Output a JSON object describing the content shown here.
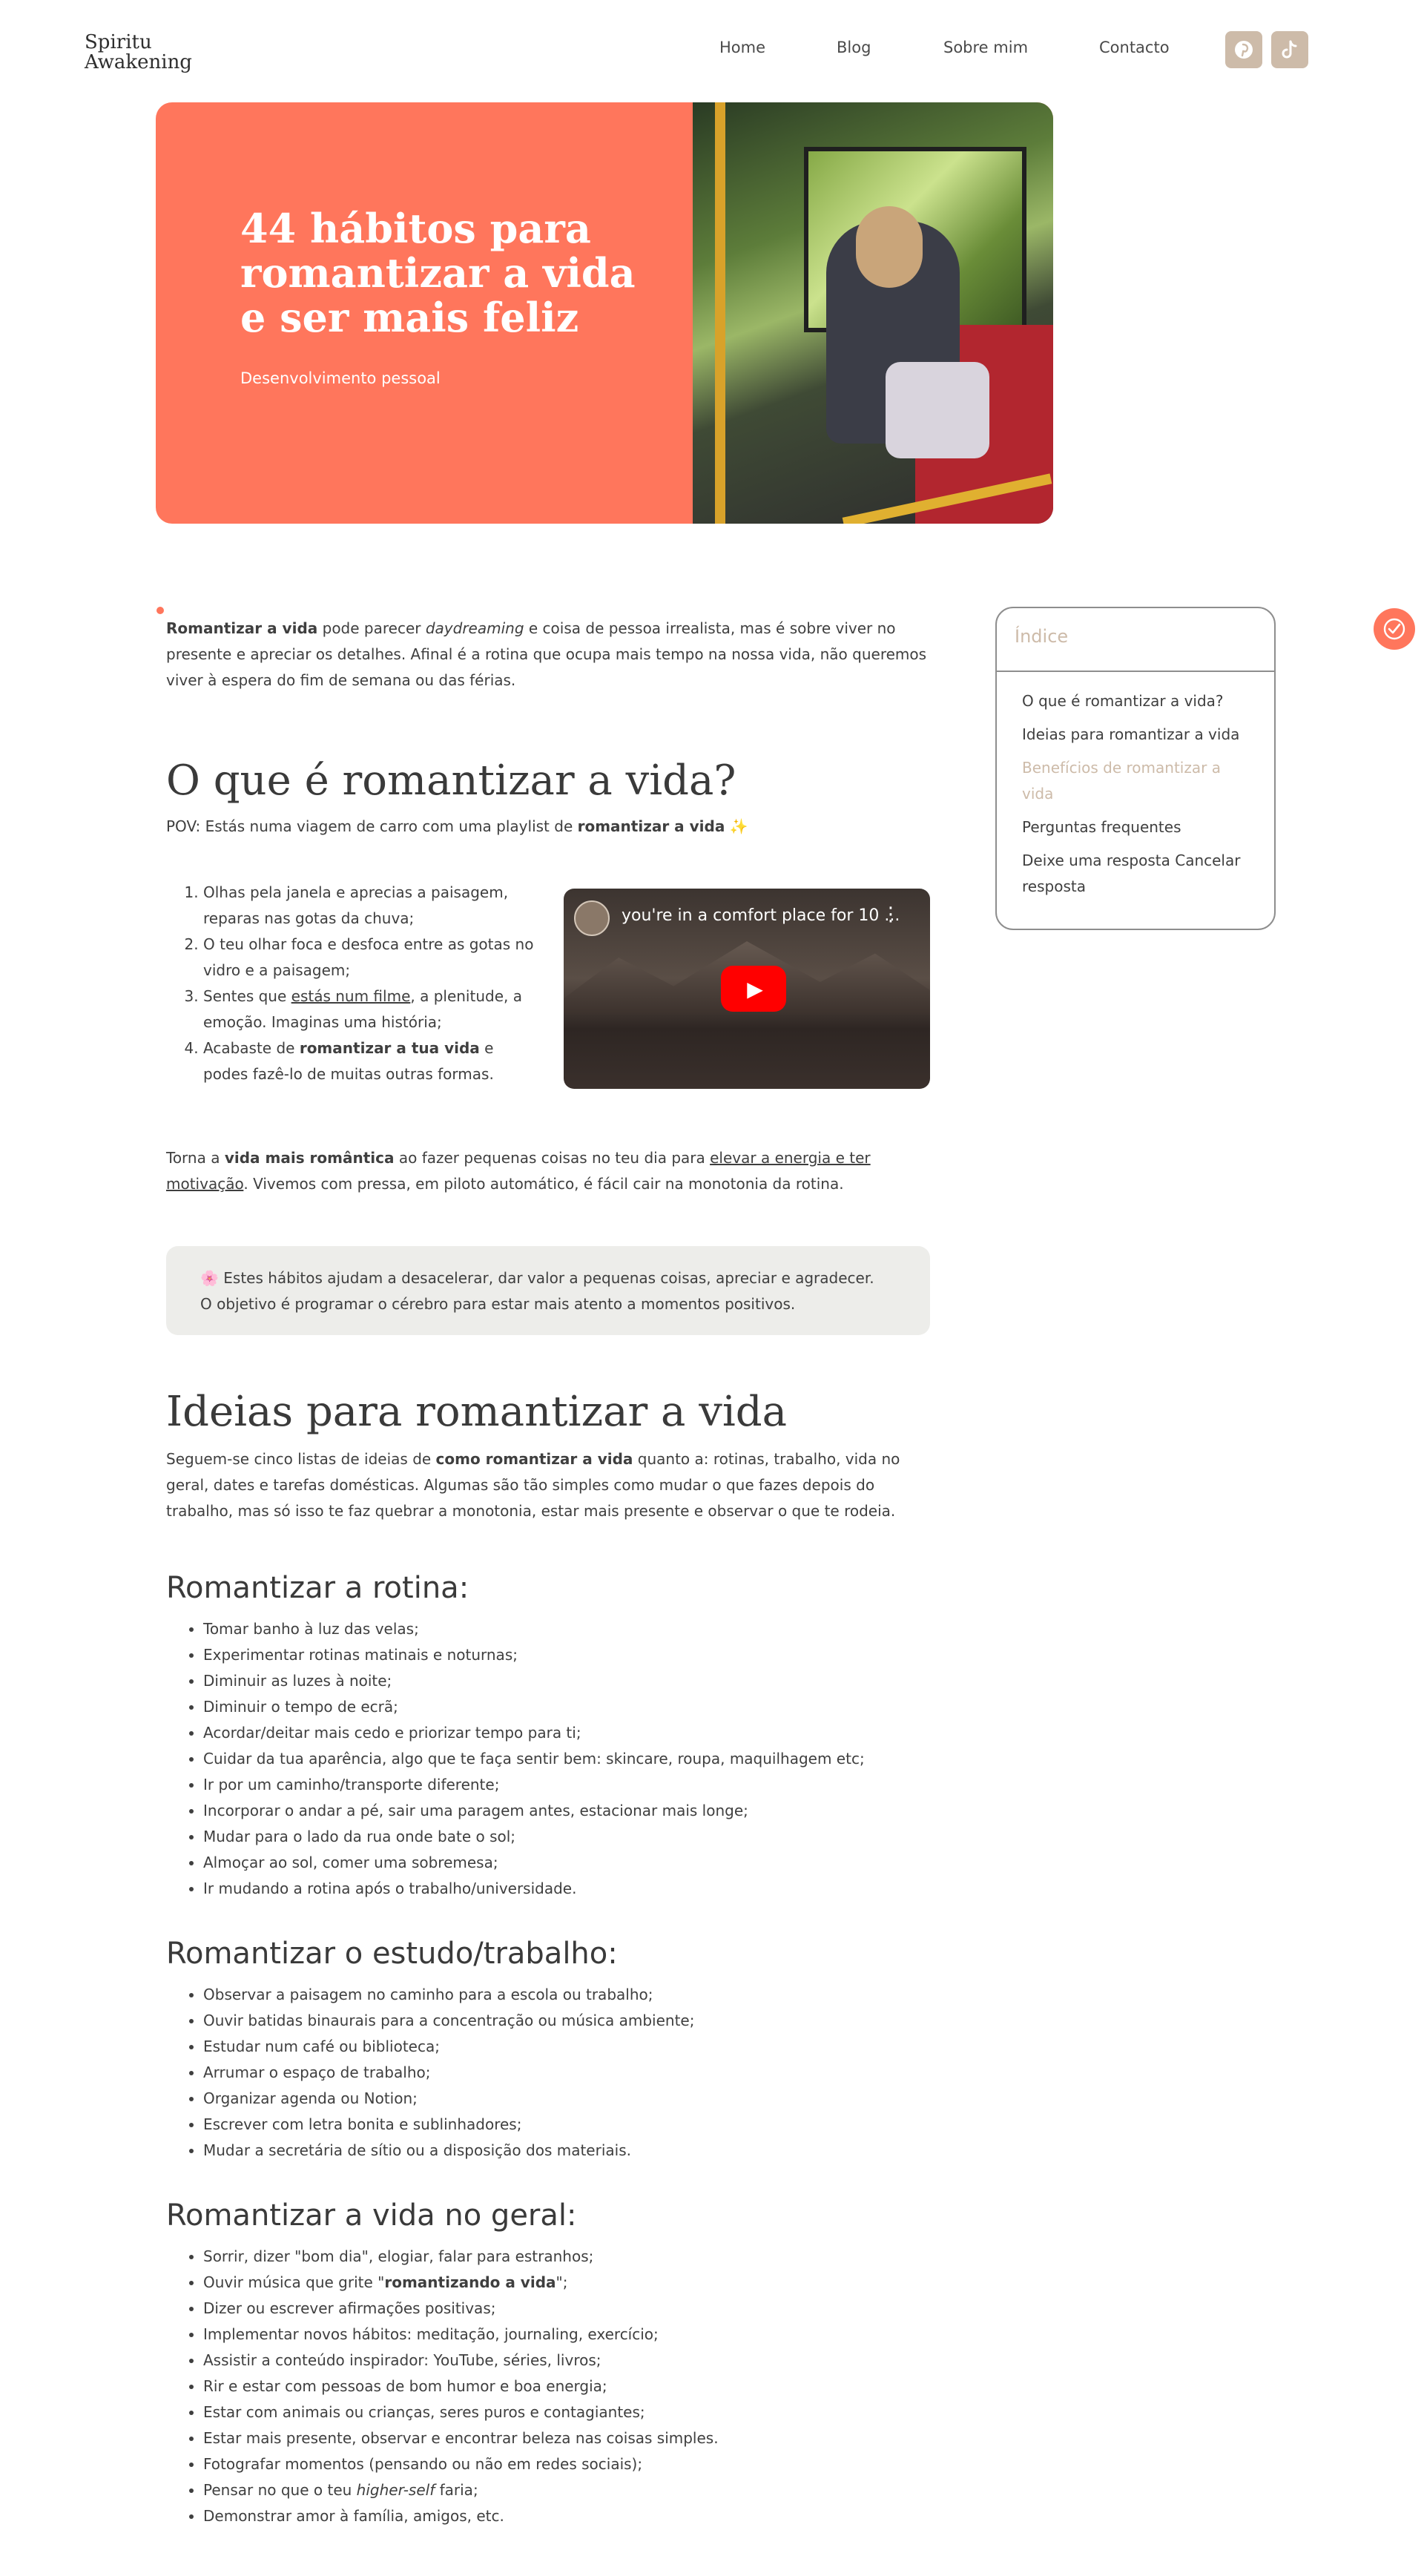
{
  "brand": {
    "logo_line1": "Spiritu",
    "logo_line2": "Awakening",
    "accent": "#ff765c",
    "beige": "#cdbba9"
  },
  "nav": {
    "home": "Home",
    "blog": "Blog",
    "sobre": "Sobre mim",
    "contacto": "Contacto"
  },
  "social": {
    "pinterest_icon": "pinterest-icon",
    "tiktok_icon": "tiktok-icon"
  },
  "hero": {
    "title": "44 hábitos para romantizar a vida e ser mais feliz",
    "category": "Desenvolvimento pessoal"
  },
  "intro": {
    "bold": "Romantizar a vida",
    "t1": " pode parecer ",
    "italic": "daydreaming",
    "t2": " e coisa de pessoa irrealista, mas é sobre viver no presente e apreciar os detalhes. Afinal é a rotina que ocupa mais tempo na nossa vida, não queremos viver à espera do fim de semana ou das férias."
  },
  "sec1": {
    "title": "O que é romantizar a vida?",
    "pov_a": "POV: Estás numa viagem de carro com uma playlist de ",
    "pov_b": "romantizar a vida",
    "pov_c": " ✨",
    "items": [
      {
        "a": "Olhas pela janela e aprecias a paisagem, reparas nas gotas da chuva;",
        "b": ""
      },
      {
        "a": "O teu olhar foca e desfoca entre as gotas no vidro e a paisagem;",
        "b": ""
      },
      {
        "a": "Sentes que ",
        "link": "estás num filme",
        "b": ", a plenitude, a emoção. Imaginas uma história;"
      },
      {
        "a": "Acabaste de ",
        "bold": "romantizar a tua vida",
        "b": " e podes fazê-lo de muitas outras formas."
      }
    ],
    "video_title": "you're in a comfort place for 10 ...",
    "para_a": "Torna a ",
    "para_b": "vida mais romântica",
    "para_c": " ao fazer pequenas coisas no teu dia para ",
    "para_link": "elevar a energia e ter motivação",
    "para_d": ". Vivemos com pressa, em piloto automático, é fácil cair na monotonia da rotina.",
    "callout_l1": "🌸 Estes hábitos ajudam a desacelerar, dar valor a pequenas coisas, apreciar e agradecer.",
    "callout_l2": "O objetivo é programar o cérebro para estar mais atento a momentos positivos."
  },
  "sec2": {
    "title": "Ideias para romantizar a vida",
    "p_a": "Seguem-se cinco listas de ideias de ",
    "p_b": "como romantizar a vida",
    "p_c": " quanto a: rotinas, trabalho, vida no geral, dates e tarefas domésticas. Algumas são tão simples como mudar o que fazes depois do trabalho, mas só isso te faz quebrar a monotonia, estar mais presente e observar o que te rodeia."
  },
  "rotina": {
    "title": "Romantizar a rotina:",
    "items": [
      "Tomar banho à luz das velas;",
      "Experimentar rotinas matinais e noturnas;",
      "Diminuir as luzes à noite;",
      "Diminuir o tempo de ecrã;",
      "Acordar/deitar mais cedo e priorizar tempo para ti;",
      "Cuidar da tua aparência, algo que te faça sentir bem: skincare, roupa, maquilhagem etc;",
      "Ir por um caminho/transporte diferente;",
      "Incorporar o andar a pé, sair uma paragem antes, estacionar mais longe;",
      "Mudar para o lado da rua onde bate o sol;",
      "Almoçar ao sol, comer uma sobremesa;",
      "Ir mudando a rotina após o trabalho/universidade."
    ]
  },
  "estudo": {
    "title": "Romantizar o estudo/trabalho:",
    "items": [
      "Observar a paisagem no caminho para a escola ou trabalho;",
      "Ouvir batidas binaurais para a concentração ou música ambiente;",
      "Estudar num café ou biblioteca;",
      "Arrumar o espaço de trabalho;",
      "Organizar agenda ou Notion;",
      "Escrever com letra bonita e sublinhadores;",
      "Mudar a secretária de sítio ou a disposição dos materiais."
    ]
  },
  "geral": {
    "title": "Romantizar a vida no geral:",
    "item1": "Sorrir, dizer \"bom dia\", elogiar, falar para estranhos;",
    "item2_a": "Ouvir música que grite \"",
    "item2_b": "romantizando a vida",
    "item2_c": "\";",
    "items": [
      "Dizer ou escrever afirmações positivas;",
      "Implementar novos hábitos: meditação, journaling, exercício;",
      "Assistir a conteúdo inspirador: YouTube, séries, livros;",
      "Rir e estar com pessoas de bom humor e boa energia;",
      "Estar com animais ou crianças, seres puros e contagiantes;",
      "Estar mais presente, observar e encontrar beleza nas coisas simples.",
      "Fotografar momentos (pensando ou não em redes sociais);"
    ],
    "item_last_a": "Pensar no que o teu ",
    "item_last_i": "higher-self",
    "item_last_b": " faria;",
    "item_final": "Demonstrar amor à família, amigos, etc."
  },
  "toc": {
    "title": "Índice",
    "items": [
      "O que é romantizar a vida?",
      "Ideias para romantizar a vida",
      "Benefícios de romantizar a vida",
      "Perguntas frequentes",
      "Deixe uma resposta Cancelar resposta"
    ]
  }
}
